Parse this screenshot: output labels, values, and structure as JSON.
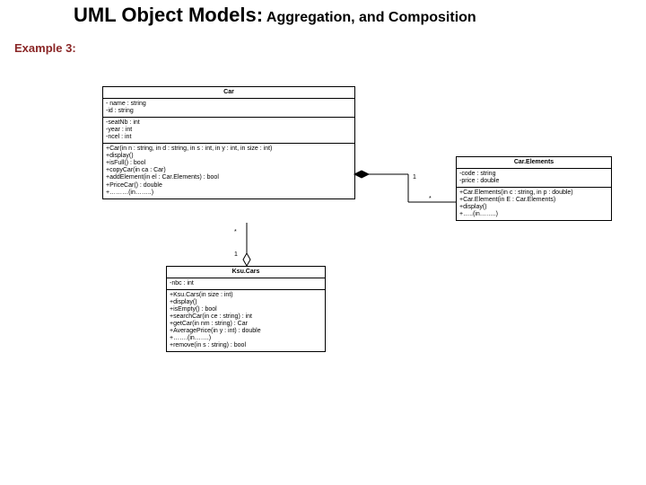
{
  "title_lead": "UML Object Models:",
  "title_sub": " Aggregation, and Composition",
  "example_label": "Example 3:",
  "car": {
    "name": "Car",
    "attrs1": [
      "- name : string",
      "-id : string"
    ],
    "attrs2": [
      "-seatNb : int",
      "-year : int",
      "-ncel : int"
    ],
    "ops": [
      "+Car(in n : string, in d : string, in s : int, in y : int, in size : int)",
      "+display()",
      "+isFull() : bool",
      "+copyCar(in ca : Car)",
      "+addElement(in el : Car.Elements) : bool",
      "+PriceCar() : double",
      "+………(in……..)"
    ]
  },
  "carElements": {
    "name": "Car.Elements",
    "attrs": [
      "-code : string",
      "-price : double"
    ],
    "ops": [
      "+Car.Elements(in c : string, in p : double)",
      "+Car.Element(in E : Car.Elements)",
      "+display()",
      "+…..(in……..)"
    ]
  },
  "ksuCars": {
    "name": "Ksu.Cars",
    "attrs": [
      "-nbc : int"
    ],
    "ops": [
      "+Ksu.Cars(in size : int)",
      "+display()",
      "+isEmpty() : bool",
      "+searchCar(in ce : string) : int",
      "+getCar(in nm : string) : Car",
      "+AveragePrice(in y : int) : double",
      "+…….(in…….)",
      "+remove(in s : string) : bool"
    ]
  },
  "mult": {
    "car_to_elements_near": "1",
    "car_to_elements_far": "*",
    "car_to_ksu_near": "*",
    "car_to_ksu_far": "1"
  }
}
